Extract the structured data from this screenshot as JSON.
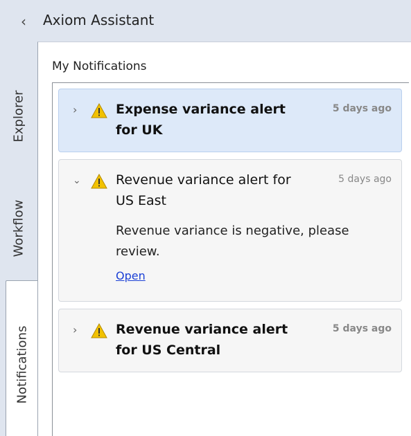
{
  "header": {
    "collapse_icon": "chevron-left-icon",
    "title": "Axiom Assistant"
  },
  "tabs": [
    {
      "label": "Explorer",
      "active": false
    },
    {
      "label": "Workflow",
      "active": false
    },
    {
      "label": "Notifications",
      "active": true
    }
  ],
  "notifications": {
    "section_label": "My Notifications",
    "items": [
      {
        "title": "Expense variance alert for UK",
        "time": "5 days ago",
        "expanded": false,
        "selected": true,
        "unread": true,
        "icon": "warning-icon"
      },
      {
        "title": "Revenue variance alert for US East",
        "time": "5 days ago",
        "expanded": true,
        "selected": false,
        "unread": false,
        "icon": "warning-icon",
        "message": "Revenue variance is negative, please review.",
        "link_label": "Open"
      },
      {
        "title": "Revenue variance alert for US Central",
        "time": "5 days ago",
        "expanded": false,
        "selected": false,
        "unread": true,
        "icon": "warning-icon"
      }
    ]
  },
  "colors": {
    "chrome_bg": "#dfe5ef",
    "selected_bg": "#dde9f9",
    "card_bg": "#f6f6f6",
    "warning_fill": "#f2c200",
    "link": "#1a3fd6"
  }
}
